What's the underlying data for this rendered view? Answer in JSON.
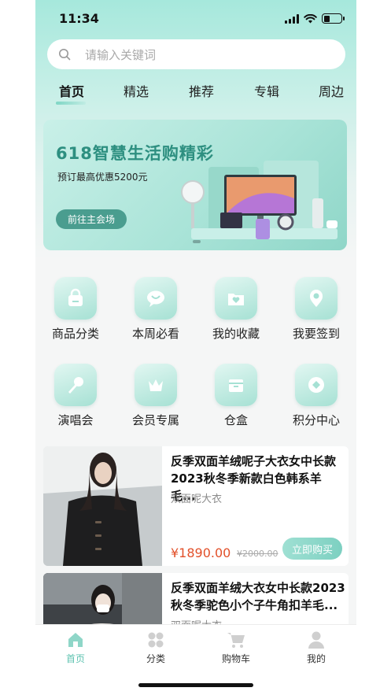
{
  "status": {
    "time": "11:34",
    "battery_level": 0.35
  },
  "search": {
    "placeholder": "请输入关键词"
  },
  "tabs": [
    {
      "label": "首页",
      "active": true
    },
    {
      "label": "精选",
      "active": false
    },
    {
      "label": "推荐",
      "active": false
    },
    {
      "label": "专辑",
      "active": false
    },
    {
      "label": "周边",
      "active": false
    }
  ],
  "banner": {
    "title": "618智慧生活购精彩",
    "subtitle": "预订最高优惠5200元",
    "button_label": "前往主会场"
  },
  "grid": [
    {
      "label": "商品分类",
      "icon": "bag-icon"
    },
    {
      "label": "本周必看",
      "icon": "chat-bubble-icon"
    },
    {
      "label": "我的收藏",
      "icon": "folder-heart-icon"
    },
    {
      "label": "我要签到",
      "icon": "location-pin-icon"
    },
    {
      "label": "演唱会",
      "icon": "microphone-icon"
    },
    {
      "label": "会员专属",
      "icon": "crown-icon"
    },
    {
      "label": "仓盒",
      "icon": "box-icon"
    },
    {
      "label": "积分中心",
      "icon": "diamond-coin-icon"
    }
  ],
  "products": [
    {
      "title": "反季双面羊绒呢子大衣女中长款2023秋冬季新款白色韩系羊毛...",
      "subtitle": "双面呢大衣",
      "price": "¥1890.00",
      "old_price": "¥2000.00",
      "buy_label": "立即购买"
    },
    {
      "title": "反季双面羊绒大衣女中长款2023秋冬季驼色小个子牛角扣羊毛...",
      "subtitle": "双面呢大衣"
    }
  ],
  "bottom_nav": [
    {
      "label": "首页",
      "icon": "home-icon",
      "active": true
    },
    {
      "label": "分类",
      "icon": "category-grid-icon",
      "active": false
    },
    {
      "label": "购物车",
      "icon": "cart-icon",
      "active": false
    },
    {
      "label": "我的",
      "icon": "user-icon",
      "active": false
    }
  ],
  "colors": {
    "accent": "#5fc3b1",
    "price": "#e2502a",
    "banner_title": "#2d8f80"
  }
}
